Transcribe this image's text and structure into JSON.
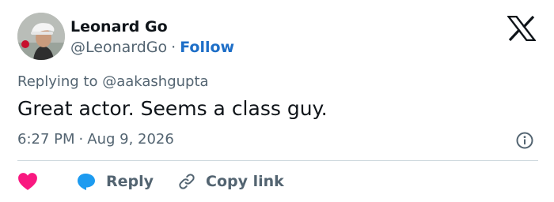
{
  "author": {
    "display_name": "Leonard Go",
    "handle": "@LeonardGo",
    "separator": "·",
    "follow_label": "Follow"
  },
  "reply_context": {
    "prefix": "Replying to",
    "mention": "@aakashgupta"
  },
  "tweet": {
    "text": "Great actor. Seems a class guy."
  },
  "meta": {
    "time": "6:27 PM",
    "separator": "·",
    "date": "Aug 9, 2026"
  },
  "actions": {
    "reply_label": "Reply",
    "copy_link_label": "Copy link"
  },
  "icons": {
    "brand": "x-logo-icon",
    "info": "info-icon",
    "like": "heart-icon",
    "reply": "speech-bubble-icon",
    "copy": "link-icon"
  },
  "colors": {
    "link": "#1d6ec7",
    "like": "#f91880",
    "reply_icon": "#1d9bf0",
    "secondary_text": "#536471",
    "primary_text": "#0f1419",
    "divider": "#cfd9de"
  }
}
